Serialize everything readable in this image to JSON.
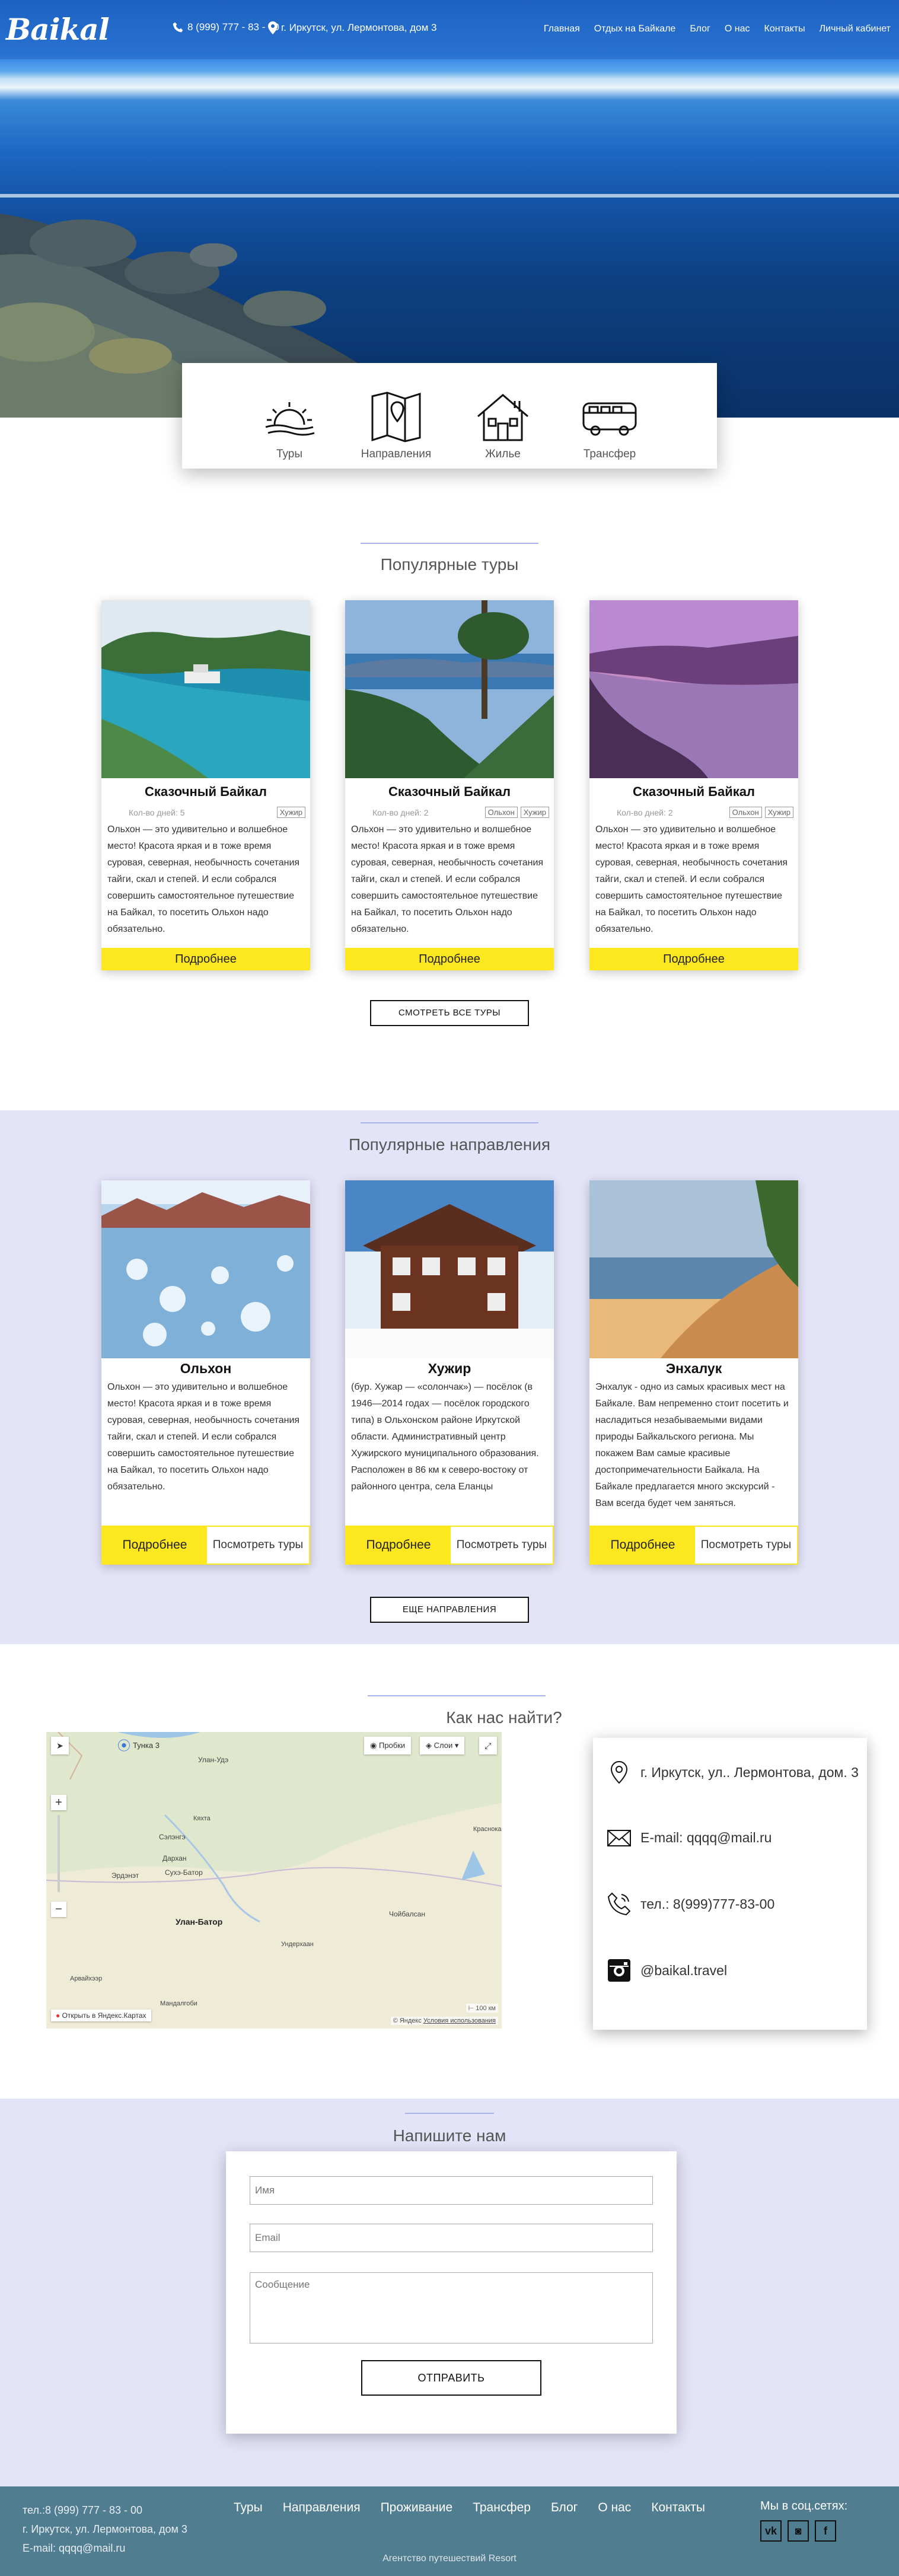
{
  "header": {
    "logo": "Baikal",
    "phone": "8 (999) 777 - 83 - 00",
    "address": "г. Иркутск, ул. Лермонтова, дом 3",
    "nav": [
      "Главная",
      "Отдых на Байкале",
      "Блог",
      "О нас",
      "Контакты",
      "Личный кабинет"
    ]
  },
  "services": [
    {
      "label": "Туры",
      "icon": "sunrise-icon"
    },
    {
      "label": "Направления",
      "icon": "map-pin-icon"
    },
    {
      "label": "Жилье",
      "icon": "house-icon"
    },
    {
      "label": "Трансфер",
      "icon": "bus-icon"
    }
  ],
  "tours": {
    "title": "Популярные туры",
    "cards": [
      {
        "name": "Сказочный Байкал",
        "days": "Кол-во дней: 5",
        "tags": [
          "Хужир"
        ],
        "text": "Ольхон — это удивительно и волшебное место! Красота яркая и в тоже время суровая, северная, необычность сочетания тайги, скал и степей. И если собрался совершить самостоятельное путешествие на Байкал, то посетить Ольхон надо обязательно.",
        "button": "Подробнее"
      },
      {
        "name": "Сказочный Байкал",
        "days": "Кол-во дней: 2",
        "tags": [
          "Ольхон",
          "Хужир"
        ],
        "text": "Ольхон — это удивительно и волшебное место! Красота яркая и в тоже время суровая, северная, необычность сочетания тайги, скал и степей. И если собрался совершить самостоятельное путешествие на Байкал, то посетить Ольхон надо обязательно.",
        "button": "Подробнее"
      },
      {
        "name": "Сказочный Байкал",
        "days": "Кол-во дней: 2",
        "tags": [
          "Ольхон",
          "Хужир"
        ],
        "text": "Ольхон — это удивительно и волшебное место! Красота яркая и в тоже время суровая, северная, необычность сочетания тайги, скал и степей. И если собрался совершить самостоятельное путешествие на Байкал, то посетить Ольхон надо обязательно.",
        "button": "Подробнее"
      }
    ],
    "all_button": "СМОТРЕТЬ ВСЕ ТУРЫ"
  },
  "destinations": {
    "title": "Популярные направления",
    "cards": [
      {
        "name": "Ольхон",
        "text": "Ольхон — это удивительно и волшебное место! Красота яркая и в тоже время суровая, северная, необычность сочетания тайги, скал и степей. И если собрался совершить самостоятельное путешествие на Байкал, то посетить Ольхон надо обязательно.",
        "more": "Подробнее",
        "tours": "Посмотреть туры"
      },
      {
        "name": "Хужир",
        "text": "(бур. Хужар — «солончак») — посёлок (в 1946—2014 годах — посёлок городского типа) в Ольхонском районе Иркутской области. Административный центр Хужирского муниципального образования. Расположен в 86 км к северо-востоку от районного центра, села Еланцы",
        "more": "Подробнее",
        "tours": "Посмотреть туры"
      },
      {
        "name": "Энхалук",
        "text": "Энхалук - одно из самых красивых мест на Байкале. Вам непременно стоит посетить и насладиться незабываемыми видами природы Байкальского региона. Мы покажем Вам самые красивые достопримечательности Байкала. На Байкале предлагается много экскурсий - Вам всегда будет чем заняться.",
        "more": "Подробнее",
        "tours": "Посмотреть туры"
      }
    ],
    "more_button": "ЕЩЕ НАПРАВЛЕНИЯ"
  },
  "find_us": {
    "title": "Как нас найти?",
    "map": {
      "traffic": "Пробки",
      "layers": "Слои",
      "search_place": "Тунка 3",
      "open_link": "Открыть в Яндекс.Картах",
      "copyright": "© Яндекс",
      "terms": "Условия использования",
      "scale": "100 км",
      "places": [
        "Улан-Удэ",
        "Сэлэнгэ",
        "Сухэ-Батор",
        "Дархан",
        "Эрдэнэт",
        "Улан-Батор",
        "Чойбалсан",
        "Ундерхаан",
        "Мандалгоби",
        "Арвайхээр",
        "Краснокам",
        "Кяхта"
      ]
    },
    "address": "г. Иркутск, ул.. Лермонтова, дом. 3",
    "email": "E-mail: qqqq@mail.ru",
    "phone": "тел.: 8(999)777-83-00",
    "instagram": "@baikal.travel"
  },
  "form": {
    "title": "Напишите нам",
    "name_placeholder": "Имя",
    "email_placeholder": "Email",
    "message_placeholder": "Сообщение",
    "submit": "ОТПРАВИТЬ"
  },
  "footer": {
    "phone": "тел.:8 (999) 777 - 83 - 00",
    "address": "г. Иркутск, ул. Лермонтова, дом 3",
    "email": "E-mail: qqqq@mail.ru",
    "nav": [
      "Туры",
      "Направления",
      "Проживание",
      "Трансфер",
      "Блог",
      "О нас",
      "Контакты"
    ],
    "social_title": "Мы в соц.сетях:",
    "social": [
      "vk-icon",
      "instagram-icon",
      "facebook-icon"
    ],
    "copyright": "Агентство путешествий Resort"
  },
  "colors": {
    "accent_yellow": "#fde71e",
    "band": "#e4e4f8",
    "footer": "#517d91",
    "header": "#2262ba"
  }
}
